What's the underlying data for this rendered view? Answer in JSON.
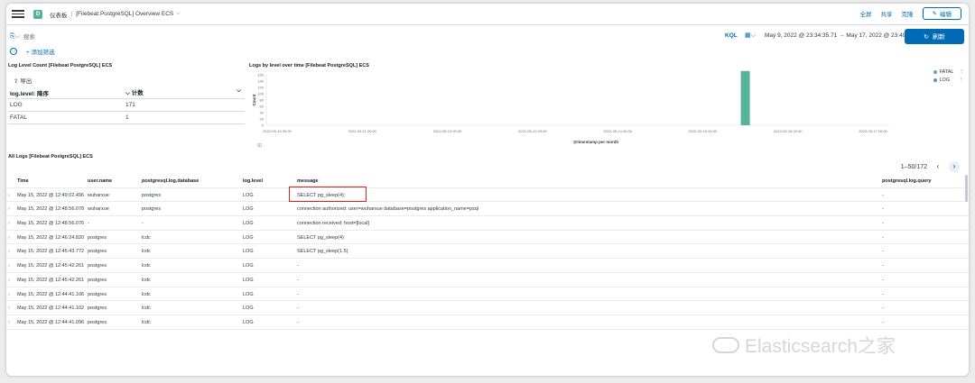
{
  "header": {
    "app_badge": "D",
    "breadcrumb_root": "仪表板",
    "breadcrumb_current": "[Filebeat PostgreSQL] Overview ECS",
    "actions": [
      "全屏",
      "共享",
      "克隆"
    ],
    "edit_label": "编辑"
  },
  "query": {
    "placeholder": "搜索",
    "language": "KQL",
    "date_range": "May 9, 2022 @ 23:34:35.71 → May 17, 2022 @ 23:49:48.30",
    "refresh_label": "刷新"
  },
  "filter": {
    "add_label": "+ 添加筛选"
  },
  "level_count_panel": {
    "title": "Log Level Count [Filebeat PostgreSQL] ECS",
    "export_label": "导出",
    "headers": [
      "log.level: 降序",
      "计数"
    ],
    "rows": [
      {
        "level": "LOG",
        "count": "171"
      },
      {
        "level": "FATAL",
        "count": "1"
      }
    ]
  },
  "chart_panel": {
    "title": "Logs by level over time [Filebeat PostgreSQL] ECS"
  },
  "chart_data": {
    "type": "bar",
    "title": "Logs by level over time [Filebeat PostgreSQL] ECS",
    "ylabel": "Count",
    "xlabel": "@timestamp per month",
    "ylim": [
      0,
      160
    ],
    "y_ticks": [
      0,
      20,
      40,
      60,
      80,
      100,
      120,
      140,
      160
    ],
    "x_ticks": [
      "2022-05-10 00:00",
      "2022-05-11 00:00",
      "2022-05-12 00:00",
      "2022-05-13 00:00",
      "2022-05-14 00:00",
      "2022-05-15 00:00",
      "2022-05-16 00:00",
      "2022-05-17 00:00"
    ],
    "series": [
      {
        "name": "FATAL",
        "color": "#54b399",
        "values": [
          {
            "x": "2022-05-15 12:00",
            "y": 1
          }
        ]
      },
      {
        "name": "LOG",
        "color": "#6092c0",
        "values": [
          {
            "x": "2022-05-15 12:00",
            "y": 171
          }
        ]
      }
    ],
    "bar_color": "#54b399",
    "legend": "top-right"
  },
  "logs_panel": {
    "title": "All Logs [Filebeat PostgreSQL] ECS",
    "pagination": "1–50/172",
    "columns": [
      "Time",
      "user.name",
      "postgresql.log.database",
      "log.level",
      "message",
      "postgresql.log.query"
    ],
    "rows": [
      [
        "May 15, 2022 @ 12:49:02.496",
        "wuharxue",
        "postgres",
        "LOG",
        "SELECT pg_sleep(4);",
        "-"
      ],
      [
        "May 15, 2022 @ 12:48:56.078",
        "wuharxue",
        "postgres",
        "LOG",
        "connection authorized: user=wuharxue database=postgres application_name=psql",
        "-"
      ],
      [
        "May 15, 2022 @ 12:48:56.076",
        "-",
        "-",
        "LOG",
        "connection received: host=[local]",
        "-"
      ],
      [
        "May 15, 2022 @ 12:46:24.820",
        "postgres",
        "lcdc",
        "LOG",
        "SELECT pg_sleep(4)",
        "-"
      ],
      [
        "May 15, 2022 @ 12:45:43.772",
        "postgres",
        "lcdc",
        "LOG",
        "SELECT pg_sleep(1.5)",
        "-"
      ],
      [
        "May 15, 2022 @ 12:45:42.261",
        "postgres",
        "lcdc",
        "LOG",
        "-",
        "-"
      ],
      [
        "May 15, 2022 @ 12:45:42.261",
        "postgres",
        "lcdc",
        "LOG",
        "-",
        "-"
      ],
      [
        "May 15, 2022 @ 12:44:41.106",
        "postgres",
        "lcdc",
        "LOG",
        "-",
        "-"
      ],
      [
        "May 15, 2022 @ 12:44:41.102",
        "postgres",
        "lcdc",
        "LOG",
        "-",
        "-"
      ],
      [
        "May 15, 2022 @ 12:44:41.096",
        "postgres",
        "lcdc",
        "LOG",
        "-",
        "-"
      ]
    ]
  },
  "watermark": "Elasticsearch之家"
}
